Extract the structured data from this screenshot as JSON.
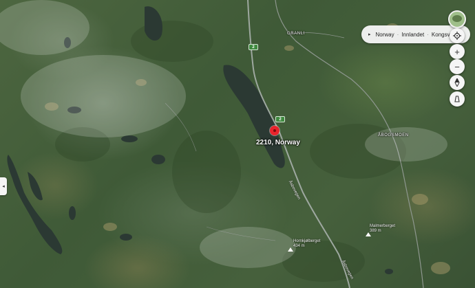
{
  "pin": {
    "label": "2210, Norway",
    "color": "#e8242c"
  },
  "places": {
    "granli": "GRANLI",
    "abogsmoen": "ÅBOGSMOEN"
  },
  "roads": {
    "route_number": "2",
    "road_name_upper": "Åsbovegen",
    "road_name_lower": "Åsbovegen"
  },
  "peaks": [
    {
      "name": "Hornkjølberget",
      "elevation": "434 m"
    },
    {
      "name": "Malmerberget",
      "elevation": "389 m"
    }
  ],
  "breadcrumb": {
    "expand_icon": "caret-right-icon",
    "items": [
      "Norway",
      "Innlandet",
      "Kongsvinger"
    ],
    "separator": "·"
  },
  "controls": {
    "layers": "globe-thumbnail",
    "locate": "locate-icon",
    "zoom_in": "+",
    "zoom_out": "−",
    "compass": "compass-icon",
    "tilt": "tilt-icon"
  },
  "side_panel": {
    "icon": "chevron-left-icon",
    "glyph": "◂"
  },
  "colors": {
    "water": "#2c3a35",
    "road": "#9ea8a0",
    "route_shield": "#3f8a3f"
  }
}
